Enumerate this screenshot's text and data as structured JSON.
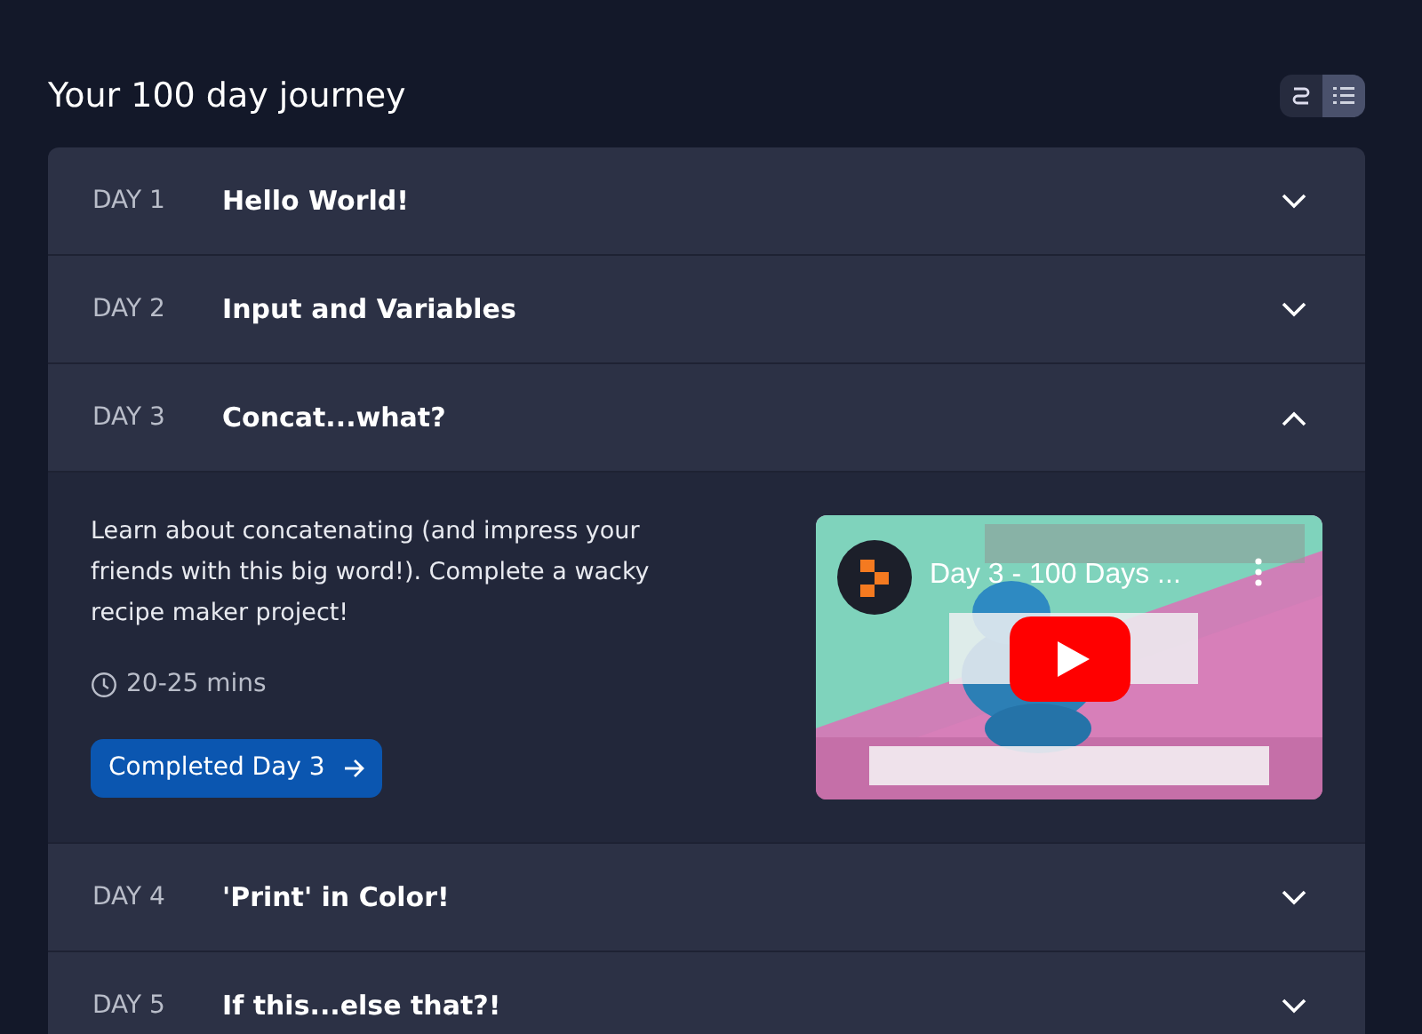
{
  "heading": "Your 100 day journey",
  "view_toggle": [
    {
      "kind": "path",
      "selected": false
    },
    {
      "kind": "list",
      "selected": true
    }
  ],
  "days": [
    {
      "day": "DAY 1",
      "title": "Hello World!",
      "expanded": false
    },
    {
      "day": "DAY 2",
      "title": "Input and Variables",
      "expanded": false
    },
    {
      "day": "DAY 3",
      "title": "Concat...what?",
      "expanded": true,
      "description": "Learn about concatenating (and impress your friends with this big word!). Complete a wacky recipe maker project!",
      "duration": "20-25 mins",
      "button": "Completed Day 3",
      "video": {
        "kind": "picture",
        "title": "Day 3 - 100 Days ..."
      }
    },
    {
      "day": "DAY 4",
      "title": "'Print' in Color!",
      "expanded": false
    },
    {
      "day": "DAY 5",
      "title": "If this...else that?!",
      "expanded": false
    }
  ]
}
